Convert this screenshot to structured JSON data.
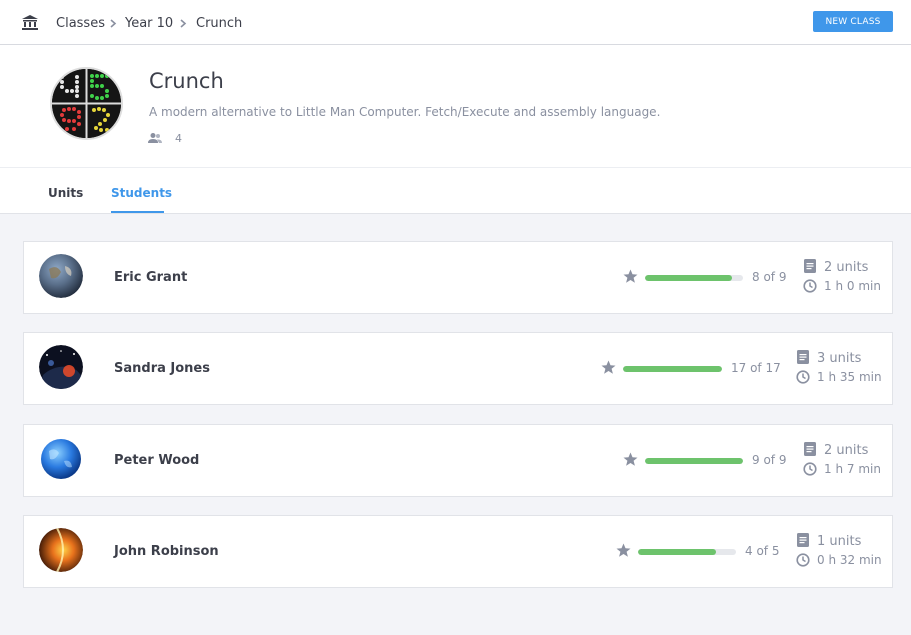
{
  "breadcrumb": {
    "items": [
      "Classes",
      "Year 10",
      "Crunch"
    ]
  },
  "toolbar": {
    "new_class_label": "NEW CLASS"
  },
  "class_info": {
    "title": "Crunch",
    "description": "A modern alternative to Little Man Computer. Fetch/Execute and assembly language.",
    "member_count": "4"
  },
  "tabs": [
    {
      "label": "Units",
      "active": false
    },
    {
      "label": "Students",
      "active": true
    }
  ],
  "students": [
    {
      "name": "Eric Grant",
      "progress_text": "8 of 9",
      "progress": 0.889,
      "units": "2 units",
      "time": "1 h 0 min"
    },
    {
      "name": "Sandra Jones",
      "progress_text": "17 of 17",
      "progress": 1.0,
      "units": "3 units",
      "time": "1 h 35 min"
    },
    {
      "name": "Peter Wood",
      "progress_text": "9 of 9",
      "progress": 1.0,
      "units": "2 units",
      "time": "1 h 7 min"
    },
    {
      "name": "John Robinson",
      "progress_text": "4 of 5",
      "progress": 0.8,
      "units": "1 units",
      "time": "0 h 32 min"
    }
  ],
  "colors": {
    "accent": "#3f97ea",
    "progress": "#6dc36c",
    "muted": "#8a90a0"
  },
  "icons": {
    "home": "bank-icon",
    "star": "star-icon",
    "units": "document-icon",
    "time": "clock-icon",
    "members": "users-icon"
  }
}
